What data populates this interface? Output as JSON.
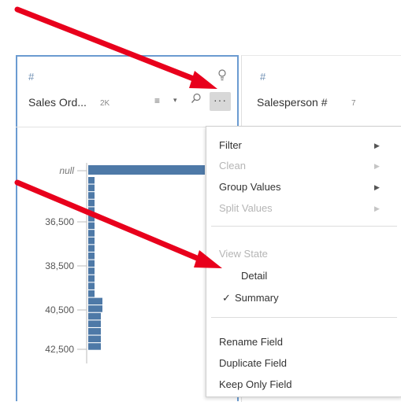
{
  "card1": {
    "type_icon": "#",
    "name": "Sales Ord...",
    "count": "2K",
    "pin_icon": "lightbulb-icon",
    "sort_icon": "≡",
    "sort_caret": "▾",
    "search_icon": "⌕",
    "more_label": "···"
  },
  "card2": {
    "type_icon": "#",
    "name": "Salesperson #",
    "count": "7"
  },
  "chart_data": {
    "type": "bar",
    "orientation": "horizontal",
    "tick_labels": [
      "null",
      "36,500",
      "38,500",
      "40,500",
      "42,500"
    ],
    "color": "#4e79a7"
  },
  "menu": {
    "items": [
      {
        "label": "Filter",
        "enabled": true,
        "submenu": true
      },
      {
        "label": "Clean",
        "enabled": false,
        "submenu": true
      },
      {
        "label": "Group Values",
        "enabled": true,
        "submenu": true
      },
      {
        "label": "Split Values",
        "enabled": false,
        "submenu": true
      }
    ],
    "view_state_label": "View State",
    "view_options": [
      {
        "label": "Detail",
        "checked": false
      },
      {
        "label": "Summary",
        "checked": true
      }
    ],
    "check_mark": "✓",
    "actions": [
      "Rename Field",
      "Duplicate Field",
      "Keep Only Field"
    ]
  },
  "colors": {
    "arrow": "#e8001c",
    "selected_border": "#6b9bd1",
    "bar": "#4e79a7"
  }
}
